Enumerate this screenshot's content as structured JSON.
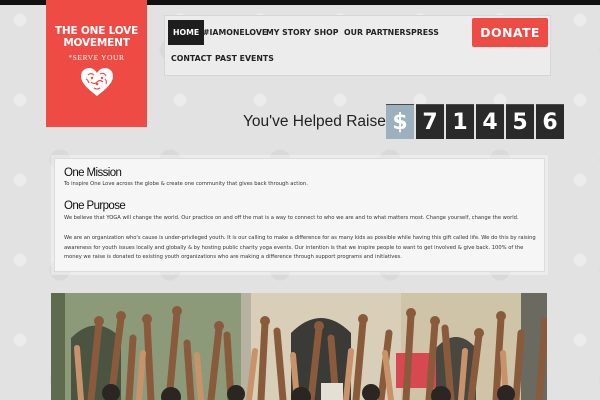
{
  "logo": {
    "title_line1": "THE ONE LOVE",
    "title_line2": "MOVEMENT",
    "tagline": "*SERVE YOUR",
    "heart_icon": "heart-icon",
    "color": "#ef4b45"
  },
  "nav": {
    "items": [
      {
        "label": "HOME",
        "active": true
      },
      {
        "label": "#IAMONELOVE"
      },
      {
        "label": "MY STORY"
      },
      {
        "label": "SHOP"
      },
      {
        "label": "OUR PARTNERS"
      },
      {
        "label": "PRESS"
      },
      {
        "label": "CONTACT"
      },
      {
        "label": "PAST EVENTS"
      }
    ]
  },
  "donate": {
    "label": "DONATE",
    "color": "#ef4b45"
  },
  "raised": {
    "label": "You've Helped Raise!",
    "currency": "$",
    "digits": [
      "7",
      "1",
      "4",
      "5",
      "6"
    ]
  },
  "mission": {
    "heading": "One Mission",
    "text": "To inspire One Love across the globe & create one community that gives back through action."
  },
  "purpose": {
    "heading": "One Purpose",
    "text1": "We believe that YOGA will change the world. Our practice on and off the mat is a way to connect to who we are and to what matters most. Change yourself, change the world.",
    "text2": "We are an organization who's cause is under-privileged youth. It is our calling to make a difference for as many kids as possible while having this gift called life. We do this by raising awareness for youth issues locally and globally & by hosting public charity yoga events. Our intention is that we inspire people to want to get involved & give back. 100% of the money we raise is donated to existing youth organizations who are making a difference through support programs and initiatives."
  },
  "colors": {
    "accent": "#ef4b45",
    "nav_active": "#1e1e1e",
    "counter_bg": "#2a2a2a",
    "counter_currency": "#9cb0be"
  }
}
